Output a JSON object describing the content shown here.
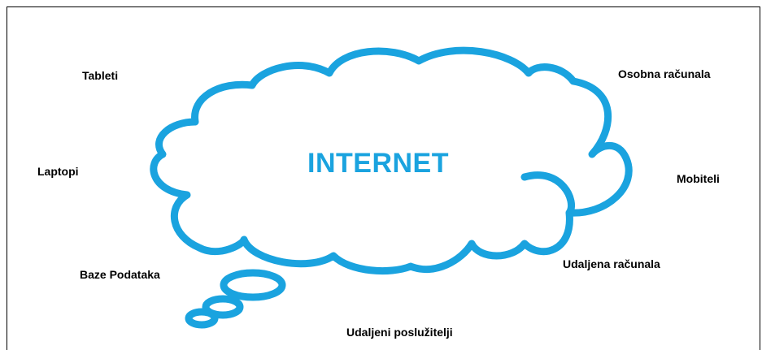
{
  "diagram": {
    "title": "INTERNET",
    "accent_color": "#1aa3df",
    "labels": {
      "tableti": "Tableti",
      "laptopi": "Laptopi",
      "baze_podataka": "Baze Podataka",
      "osobna_racunala": "Osobna računala",
      "mobiteli": "Mobiteli",
      "udaljena_racunala": "Udaljena računala",
      "udaljeni_posluzitelji": "Udaljeni poslužitelji"
    }
  }
}
